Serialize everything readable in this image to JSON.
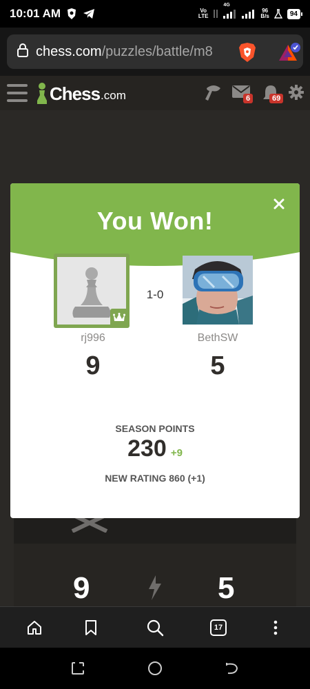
{
  "status_bar": {
    "time": "10:01 AM",
    "net_top": "Vo",
    "net_bottom": "LTE",
    "signal_label": "4G",
    "speed_top": "96",
    "speed_bottom": "B/s",
    "battery": "94"
  },
  "browser": {
    "url_domain": "chess.com",
    "url_path": "/puzzles/battle/m8"
  },
  "header": {
    "logo_text": "Chess",
    "logo_suffix": ".com",
    "messages_badge": "6",
    "notifications_badge": "69"
  },
  "modal": {
    "title": "You Won!",
    "result": "1-0",
    "player1": {
      "name": "rj996",
      "score": "9"
    },
    "player2": {
      "name": "BethSW",
      "score": "5"
    },
    "season_label": "SEASON POINTS",
    "season_points": "230",
    "season_delta": "+9",
    "rating_text": "NEW RATING 860 (+1)"
  },
  "background_page": {
    "left_score": "9",
    "right_score": "5"
  },
  "bottom_nav": {
    "tab_count": "17"
  },
  "colors": {
    "accent_green": "#81b64c",
    "badge_red": "#c8342b",
    "header_bg": "#262421"
  }
}
